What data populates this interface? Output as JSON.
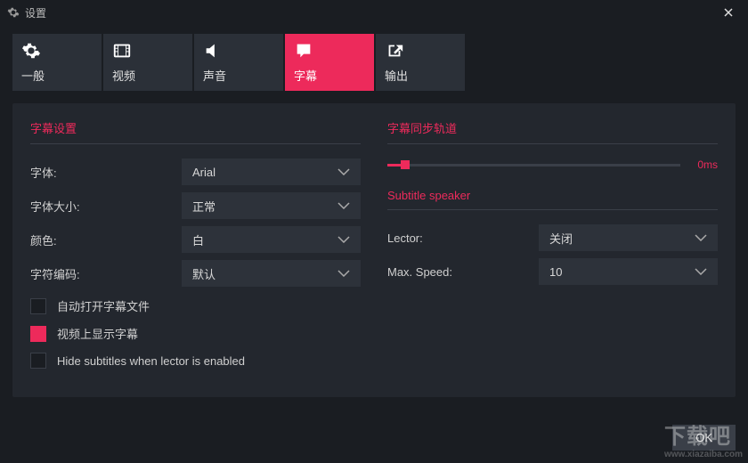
{
  "window": {
    "title": "设置"
  },
  "tabs": {
    "general": "一般",
    "video": "视频",
    "audio": "声音",
    "subtitle": "字幕",
    "output": "输出"
  },
  "left": {
    "section_title": "字幕设置",
    "font_label": "字体:",
    "font_value": "Arial",
    "size_label": "字体大小:",
    "size_value": "正常",
    "color_label": "颜色:",
    "color_value": "白",
    "encoding_label": "字符编码:",
    "encoding_value": "默认",
    "auto_open": "自动打开字幕文件",
    "show_on_video": "视频上显示字幕",
    "hide_when_lector": "Hide subtitles when lector is enabled"
  },
  "right": {
    "section_title": "字幕同步轨道",
    "sync_value": "0ms",
    "speaker_header": "Subtitle speaker",
    "lector_label": "Lector:",
    "lector_value": "关闭",
    "maxspeed_label": "Max. Speed:",
    "maxspeed_value": "10"
  },
  "footer": {
    "ok": "OK"
  },
  "watermark": {
    "main": "下载吧",
    "sub": "www.xiazaiba.com"
  }
}
